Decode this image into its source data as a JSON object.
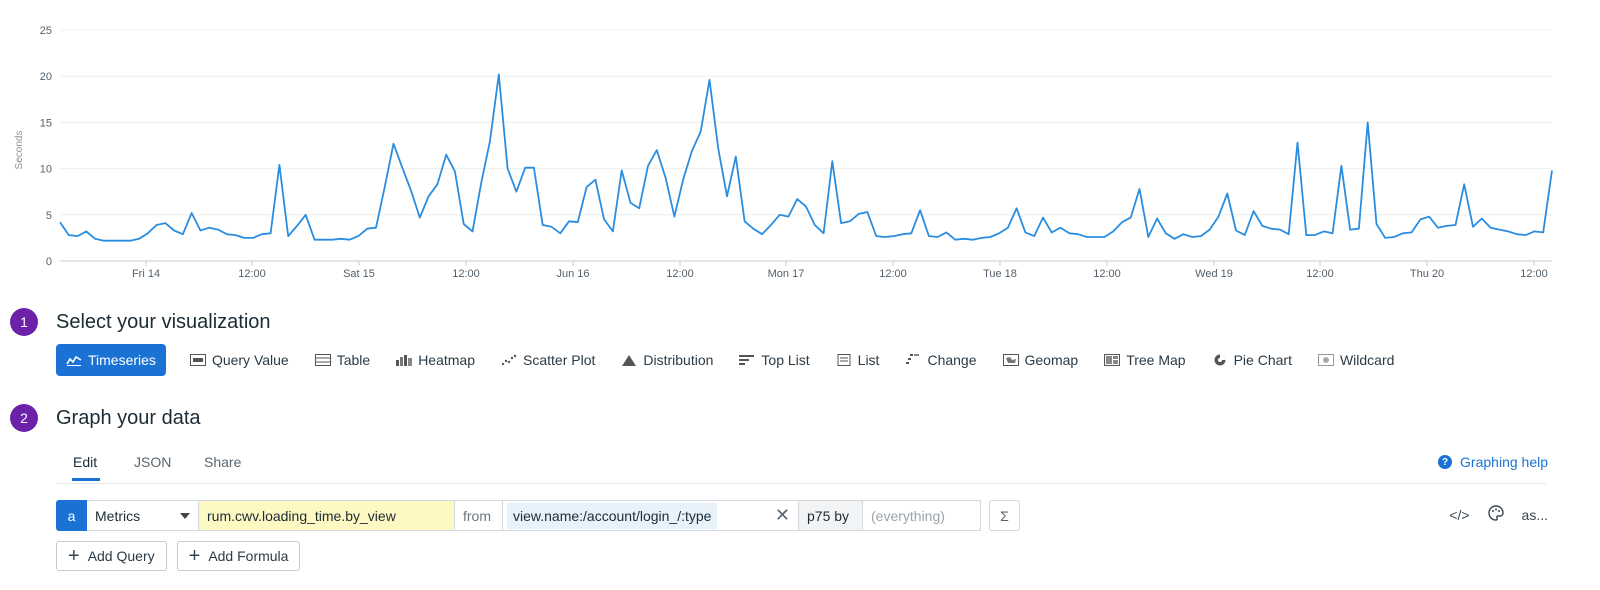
{
  "chart_data": {
    "type": "line",
    "ylabel": "Seconds",
    "ylim": [
      0,
      25
    ],
    "yticks": [
      0,
      5,
      10,
      15,
      20,
      25
    ],
    "grid": true,
    "color": "#2b8de0",
    "xticks": [
      "Fri 14",
      "12:00",
      "Sat 15",
      "12:00",
      "Jun 16",
      "12:00",
      "Mon 17",
      "12:00",
      "Tue 18",
      "12:00",
      "Wed 19",
      "12:00",
      "Thu 20",
      "12:00"
    ],
    "values": [
      4.2,
      2.8,
      2.7,
      3.2,
      2.4,
      2.2,
      2.2,
      2.2,
      2.2,
      2.4,
      3.0,
      3.9,
      4.1,
      3.3,
      2.9,
      5.2,
      3.3,
      3.6,
      3.4,
      2.9,
      2.8,
      2.5,
      2.5,
      2.9,
      3.0,
      10.4,
      2.7,
      3.8,
      5.0,
      2.3,
      2.3,
      2.3,
      2.4,
      2.3,
      2.7,
      3.5,
      3.6,
      8.0,
      12.7,
      10.1,
      7.6,
      4.7,
      7.0,
      8.3,
      11.5,
      9.7,
      4.0,
      3.2,
      8.5,
      13.0,
      20.2,
      10.0,
      7.5,
      10.1,
      10.1,
      3.9,
      3.7,
      3.0,
      4.3,
      4.2,
      8.0,
      8.8,
      4.5,
      3.2,
      9.8,
      6.3,
      5.7,
      10.3,
      12.0,
      9.0,
      4.8,
      8.8,
      11.9,
      14.0,
      19.6,
      12.2,
      7.0,
      11.3,
      4.3,
      3.5,
      2.9,
      3.9,
      5.0,
      4.8,
      6.7,
      5.9,
      3.9,
      3.0,
      10.8,
      4.1,
      4.3,
      5.1,
      5.3,
      2.7,
      2.6,
      2.7,
      2.9,
      3.0,
      5.5,
      2.7,
      2.6,
      3.1,
      2.3,
      2.4,
      2.3,
      2.5,
      2.6,
      3.0,
      3.6,
      5.7,
      3.1,
      2.7,
      4.7,
      3.1,
      3.6,
      3.0,
      2.9,
      2.6,
      2.6,
      2.6,
      3.2,
      4.2,
      4.7,
      7.8,
      2.6,
      4.6,
      3.0,
      2.4,
      2.9,
      2.6,
      2.7,
      3.4,
      4.8,
      7.3,
      3.3,
      2.8,
      5.4,
      3.8,
      3.5,
      3.4,
      2.9,
      12.8,
      2.8,
      2.8,
      3.2,
      3.0,
      10.3,
      3.4,
      3.5,
      15.0,
      4.0,
      2.5,
      2.6,
      3.0,
      3.1,
      4.5,
      4.8,
      3.6,
      3.8,
      3.9,
      8.3,
      3.7,
      4.6,
      3.6,
      3.4,
      3.2,
      2.9,
      2.8,
      3.2,
      3.1,
      9.8
    ]
  },
  "steps": {
    "visualization": {
      "num": "1",
      "title": "Select your visualization"
    },
    "graph": {
      "num": "2",
      "title": "Graph your data"
    }
  },
  "visualizations": [
    {
      "label": "Timeseries",
      "icon": "timeseries-icon",
      "selected": true
    },
    {
      "label": "Query Value",
      "icon": "query-value-icon"
    },
    {
      "label": "Table",
      "icon": "table-icon"
    },
    {
      "label": "Heatmap",
      "icon": "heatmap-icon"
    },
    {
      "label": "Scatter Plot",
      "icon": "scatter-plot-icon"
    },
    {
      "label": "Distribution",
      "icon": "distribution-icon"
    },
    {
      "label": "Top List",
      "icon": "top-list-icon"
    },
    {
      "label": "List",
      "icon": "list-icon"
    },
    {
      "label": "Change",
      "icon": "change-icon"
    },
    {
      "label": "Geomap",
      "icon": "geomap-icon"
    },
    {
      "label": "Tree Map",
      "icon": "tree-map-icon"
    },
    {
      "label": "Pie Chart",
      "icon": "pie-chart-icon"
    },
    {
      "label": "Wildcard",
      "icon": "wildcard-icon"
    }
  ],
  "tabs": {
    "edit": "Edit",
    "json": "JSON",
    "share": "Share",
    "active": "Edit"
  },
  "help": {
    "label": "Graphing help",
    "icon": "question-icon"
  },
  "query": {
    "letter": "a",
    "source": "Metrics",
    "metric": "rum.cwv.loading_time.by_view",
    "from_label": "from",
    "scope": "view.name:/account/login_/:type",
    "aggregation": "p75 by",
    "group_placeholder": "(everything)",
    "sigma": "Σ"
  },
  "tools": {
    "code": "</>",
    "palette_icon": "palette-icon",
    "alias": "as..."
  },
  "buttons": {
    "add_query": "Add Query",
    "add_formula": "Add Formula"
  }
}
